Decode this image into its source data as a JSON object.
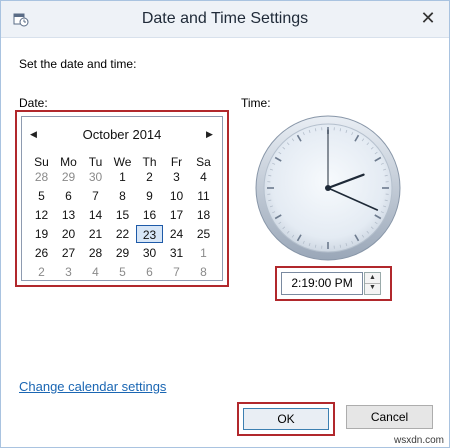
{
  "window": {
    "title": "Date and Time Settings",
    "close_glyph": "✕",
    "app_icon": "date-time-icon"
  },
  "labels": {
    "heading": "Set the date and time:",
    "date": "Date:",
    "time": "Time:"
  },
  "calendar": {
    "month_year": "October 2014",
    "prev_glyph": "◀",
    "next_glyph": "▶",
    "weekdays": [
      "Su",
      "Mo",
      "Tu",
      "We",
      "Th",
      "Fr",
      "Sa"
    ],
    "weeks": [
      [
        "28",
        "29",
        "30",
        "1",
        "2",
        "3",
        "4"
      ],
      [
        "5",
        "6",
        "7",
        "8",
        "9",
        "10",
        "11"
      ],
      [
        "12",
        "13",
        "14",
        "15",
        "16",
        "17",
        "18"
      ],
      [
        "19",
        "20",
        "21",
        "22",
        "23",
        "24",
        "25"
      ],
      [
        "26",
        "27",
        "28",
        "29",
        "30",
        "31",
        "1"
      ],
      [
        "2",
        "3",
        "4",
        "5",
        "6",
        "7",
        "8"
      ]
    ],
    "selected_day": "23"
  },
  "clock": {
    "hours": 2,
    "minutes": 19,
    "seconds": 0
  },
  "time_field": {
    "value": "2:19:00 PM",
    "spin_up": "▲",
    "spin_down": "▼"
  },
  "link": {
    "text": "Change calendar settings"
  },
  "buttons": {
    "ok": "OK",
    "cancel": "Cancel"
  },
  "watermark": "wsxdn.com",
  "colors": {
    "highlight_border": "#b1282c",
    "link": "#1a66b3",
    "selection": "#1e5aa8"
  }
}
